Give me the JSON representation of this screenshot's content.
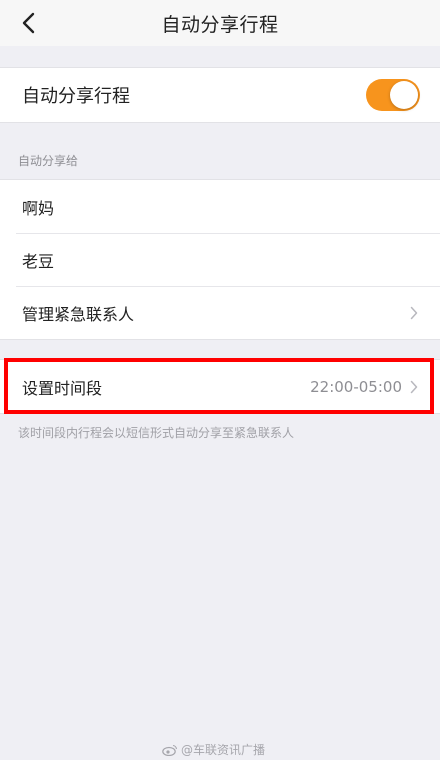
{
  "navbar": {
    "title": "自动分享行程",
    "back_icon": "chevron-left-icon"
  },
  "auto_share": {
    "label": "自动分享行程",
    "enabled": true,
    "toggle_color": "#f7941d"
  },
  "contacts_section": {
    "header": "自动分享给",
    "contacts": [
      "啊妈",
      "老豆"
    ],
    "manage_label": "管理紧急联系人"
  },
  "time_period": {
    "label": "设置时间段",
    "value": "22:00-05:00",
    "footnote": "该时间段内行程会以短信形式自动分享至紧急联系人"
  },
  "highlight_color": "#ff0000",
  "watermark": {
    "text": "@车联资讯广播",
    "icon": "weibo-icon"
  }
}
